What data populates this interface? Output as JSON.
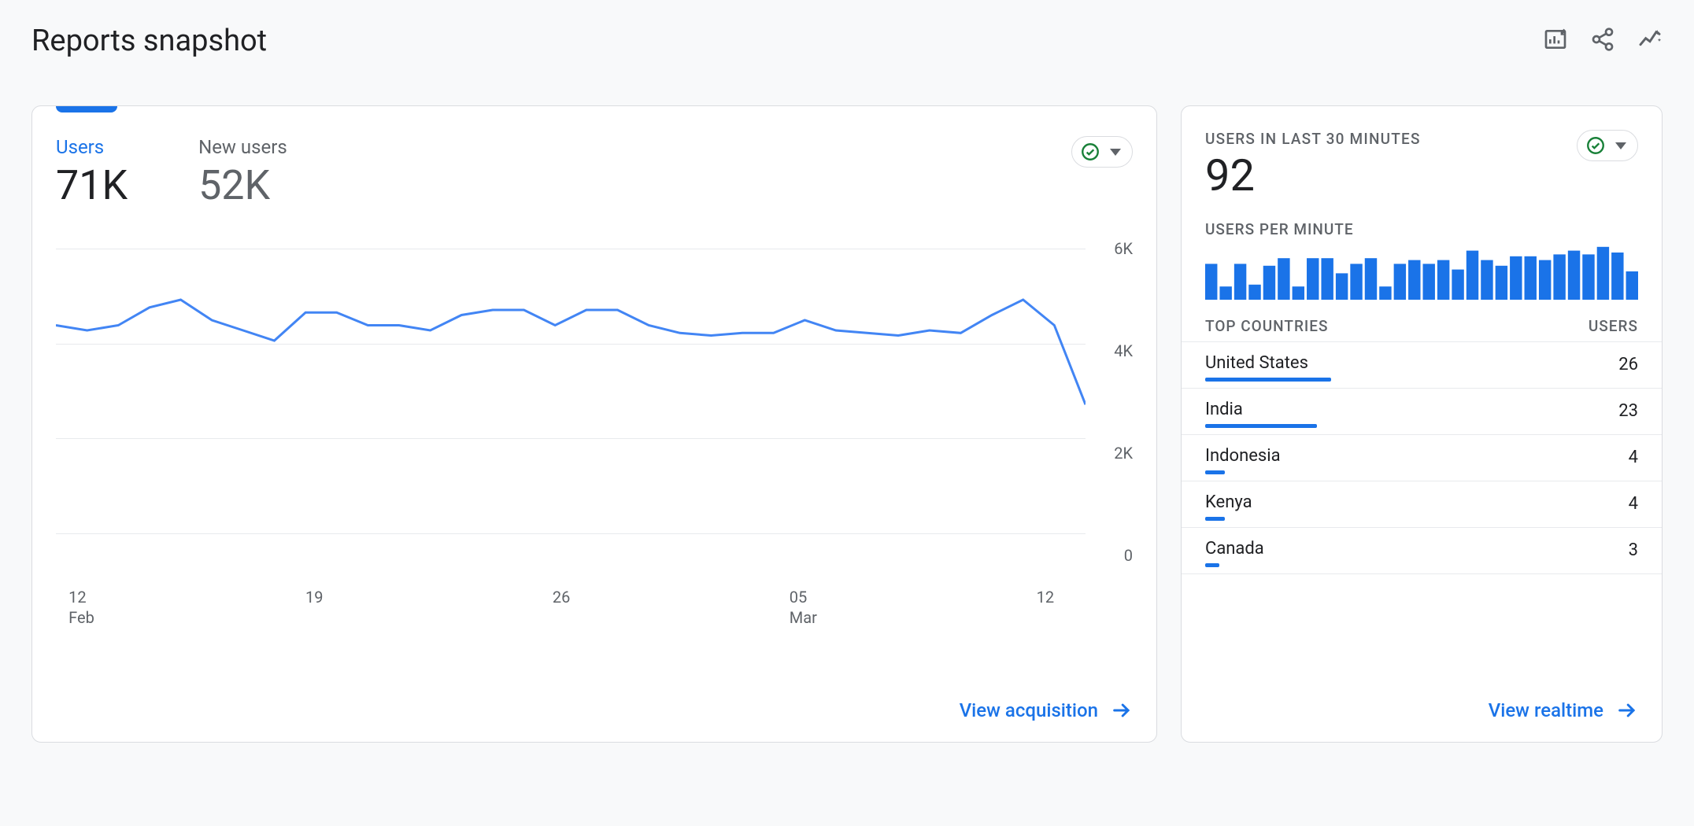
{
  "page_title": "Reports snapshot",
  "header_icons": [
    "edit-chart-icon",
    "share-icon",
    "insights-icon"
  ],
  "main_card": {
    "metrics": [
      {
        "label": "Users",
        "value": "71K",
        "active": true
      },
      {
        "label": "New users",
        "value": "52K",
        "active": false
      }
    ],
    "footer_link": "View acquisition"
  },
  "realtime_card": {
    "heading": "USERS IN LAST 30 MINUTES",
    "value": "92",
    "subheading": "USERS PER MINUTE",
    "countries_header": {
      "left": "TOP COUNTRIES",
      "right": "USERS"
    },
    "countries": [
      {
        "name": "United States",
        "users": 26
      },
      {
        "name": "India",
        "users": 23
      },
      {
        "name": "Indonesia",
        "users": 4
      },
      {
        "name": "Kenya",
        "users": 4
      },
      {
        "name": "Canada",
        "users": 3
      }
    ],
    "footer_link": "View realtime"
  },
  "chart_data": {
    "main_line": {
      "type": "line",
      "title": "",
      "xlabel": "",
      "ylabel": "",
      "ylim": [
        0,
        6000
      ],
      "y_ticks": [
        "0",
        "2K",
        "4K",
        "6K"
      ],
      "x_ticks": [
        {
          "pos": 0.02,
          "label": "12",
          "sublabel": "Feb"
        },
        {
          "pos": 0.25,
          "label": "19",
          "sublabel": ""
        },
        {
          "pos": 0.49,
          "label": "26",
          "sublabel": ""
        },
        {
          "pos": 0.72,
          "label": "05",
          "sublabel": "Mar"
        },
        {
          "pos": 0.96,
          "label": "12",
          "sublabel": ""
        }
      ],
      "series": [
        {
          "name": "Users",
          "color": "#4285f4",
          "values": [
            4500,
            4400,
            4500,
            4850,
            5000,
            4600,
            4400,
            4200,
            4750,
            4750,
            4500,
            4500,
            4400,
            4700,
            4800,
            4800,
            4500,
            4800,
            4800,
            4500,
            4350,
            4300,
            4350,
            4350,
            4600,
            4400,
            4350,
            4300,
            4400,
            4350,
            4700,
            5000,
            4500,
            2950
          ]
        }
      ]
    },
    "spark_bars": {
      "type": "bar",
      "title": "Users per minute",
      "ylim": [
        0,
        60
      ],
      "values": [
        38,
        14,
        38,
        16,
        36,
        44,
        14,
        44,
        44,
        28,
        38,
        44,
        14,
        38,
        42,
        38,
        42,
        32,
        52,
        42,
        36,
        46,
        46,
        42,
        48,
        52,
        48,
        56,
        50,
        30
      ]
    }
  }
}
